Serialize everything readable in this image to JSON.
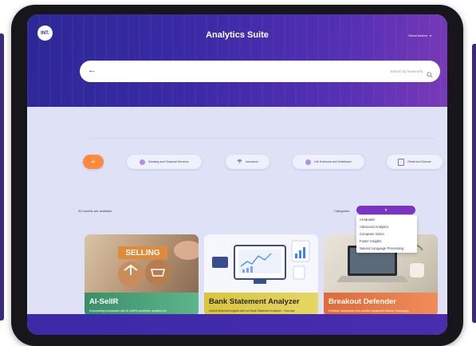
{
  "header": {
    "logo_text": "INT.",
    "app_title": "Analytics Suite",
    "user_name": "Rahul.mishra",
    "user_caret": "▾"
  },
  "search": {
    "back_glyph": "←",
    "placeholder": "Search by keywords",
    "icon": "search-icon"
  },
  "filters": {
    "chips": [
      {
        "label": "All",
        "icon": "",
        "active": true
      },
      {
        "label": "Banking and Financial Services",
        "icon": "bank-icon",
        "active": false
      },
      {
        "label": "Insurance",
        "icon": "umbrella-icon",
        "active": false
      },
      {
        "label": "Life Sciences and Healthcare",
        "icon": "health-icon",
        "active": false
      },
      {
        "label": "Retail and Diverse",
        "icon": "retail-icon",
        "active": false
      }
    ]
  },
  "models": {
    "count_text": "33 models are available"
  },
  "categories": {
    "label": "Categories",
    "selected_value": "▾",
    "options": [
      "All Models",
      "Advanced Analytics",
      "Computer Vision",
      "Faster Insights",
      "Natural Language Processing"
    ]
  },
  "cards": [
    {
      "title": "AI-SellR",
      "image_text": "SELLING",
      "description": "Empowering businesses with AI-SellR's predictive analytics for"
    },
    {
      "title": "Bank Statement Analyzer",
      "description": "Unlock financial insights with our Bank Statement Analyzer - Your key"
    },
    {
      "title": "Breakout Defender",
      "description": "It shields businesses from sudden equipment failures, leveraging"
    }
  ],
  "colors": {
    "header_gradient_start": "#2c2896",
    "header_gradient_end": "#7a3ab8",
    "accent_orange": "#ff8a3d",
    "select_purple": "#7a34c4",
    "page_background": "#dfe2f6"
  }
}
